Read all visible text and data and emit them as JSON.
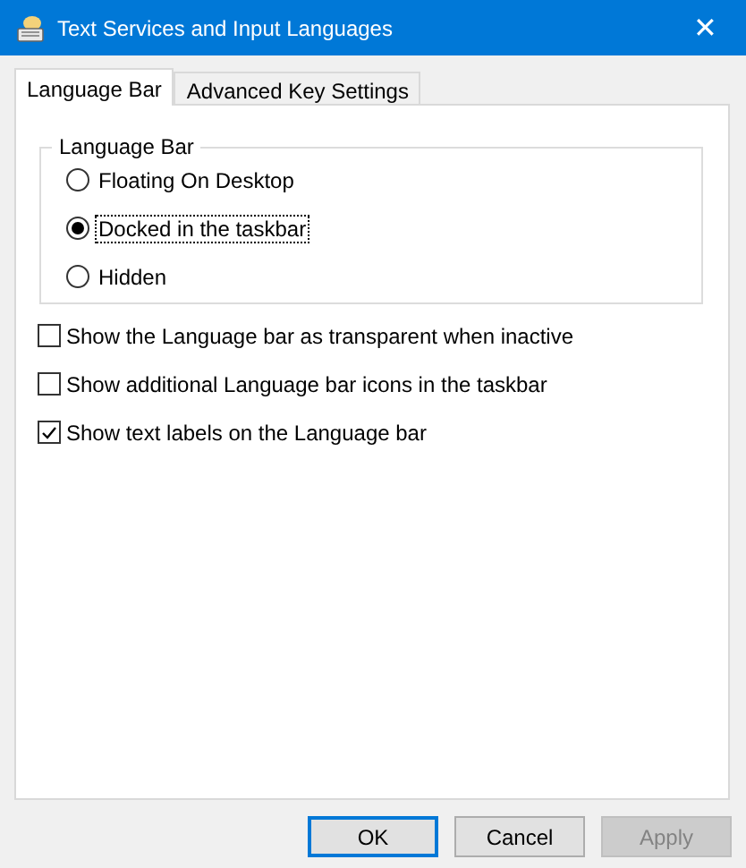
{
  "window": {
    "title": "Text Services and Input Languages",
    "close": "✕"
  },
  "tabs": [
    {
      "label": "Language Bar",
      "selected": true
    },
    {
      "label": "Advanced Key Settings",
      "selected": false
    }
  ],
  "group": {
    "title": "Language Bar",
    "options": [
      {
        "label": "Floating On Desktop",
        "selected": false
      },
      {
        "label": "Docked in the taskbar",
        "selected": true
      },
      {
        "label": "Hidden",
        "selected": false
      }
    ]
  },
  "checkboxes": [
    {
      "label": "Show the Language bar as transparent when inactive",
      "checked": false
    },
    {
      "label": "Show additional Language bar icons in the taskbar",
      "checked": false
    },
    {
      "label": "Show text labels on the Language bar",
      "checked": true
    }
  ],
  "buttons": [
    {
      "label": "OK",
      "default": true,
      "disabled": false
    },
    {
      "label": "Cancel",
      "default": false,
      "disabled": false
    },
    {
      "label": "Apply",
      "default": false,
      "disabled": true
    }
  ]
}
